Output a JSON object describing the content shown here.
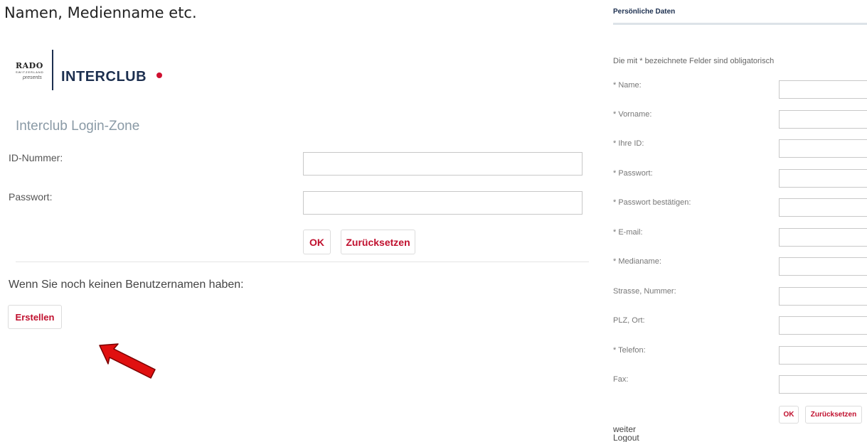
{
  "caption": "Namen, Medienname etc.",
  "logo": {
    "brand": "RADO",
    "tagline": "SWITZERLAND",
    "presents": "presents",
    "name": "INTERCLUB"
  },
  "login": {
    "title": "Interclub Login-Zone",
    "id_label": "ID-Nummer:",
    "id_value": "",
    "password_label": "Passwort:",
    "password_value": "",
    "ok_label": "OK",
    "reset_label": "Zurücksetzen",
    "register_text": "Wenn Sie noch keinen Benutzernamen haben:",
    "create_label": "Erstellen"
  },
  "annotation": {
    "arrow_color": "#e01010"
  },
  "personal": {
    "title": "Persönliche Daten",
    "hint": "Die mit * bezeichnete Felder sind obligatorisch",
    "fields": [
      {
        "label": "* Name:",
        "value": ""
      },
      {
        "label": "* Vorname:",
        "value": ""
      },
      {
        "label": "* Ihre ID:",
        "value": ""
      },
      {
        "label": "* Passwort:",
        "value": ""
      },
      {
        "label": "* Passwort bestätigen:",
        "value": ""
      },
      {
        "label": "* E-mail:",
        "value": ""
      },
      {
        "label": "* Medianame:",
        "value": ""
      },
      {
        "label": "Strasse, Nummer:",
        "value": ""
      },
      {
        "label": "PLZ, Ort:",
        "value": ""
      },
      {
        "label": "* Telefon:",
        "value": ""
      },
      {
        "label": "Fax:",
        "value": ""
      }
    ],
    "ok_label": "OK",
    "reset_label": "Zurücksetzen",
    "links": [
      "weiter",
      "Logout"
    ]
  },
  "colors": {
    "accent": "#c0102e",
    "brand_navy": "#1c2f4f",
    "muted_title": "#8a9aa6"
  }
}
